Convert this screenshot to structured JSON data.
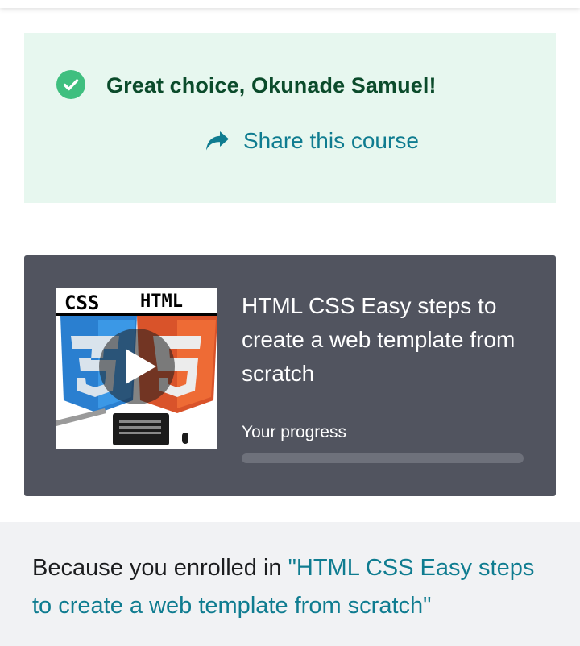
{
  "banner": {
    "message": "Great choice, Okunade Samuel!",
    "share_label": "Share this course",
    "accent_color": "#3fbf7f",
    "link_color": "#0f7c90"
  },
  "course": {
    "title": "HTML CSS Easy steps to create a web template from scratch",
    "thumbnail_text_left": "CSS",
    "thumbnail_text_right": "HTML",
    "progress_label": "Your progress",
    "progress_fraction": 0
  },
  "recommendation": {
    "prefix": "Because you enrolled in ",
    "course_link": "\"HTML CSS Easy steps to create a web template from scratch\""
  }
}
